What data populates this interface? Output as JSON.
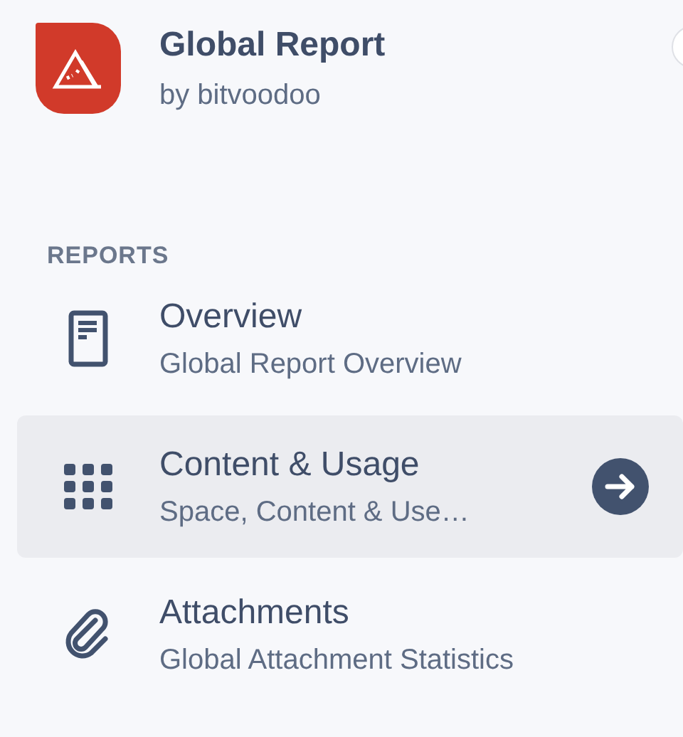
{
  "app": {
    "title": "Global Report",
    "subtitle": "by bitvoodoo"
  },
  "section": {
    "heading": "REPORTS"
  },
  "items": [
    {
      "kind": "document",
      "title": "Overview",
      "subtitle": "Global Report Overview",
      "selected": false
    },
    {
      "kind": "grid",
      "title": "Content & Usage",
      "subtitle": "Space, Content & Use…",
      "selected": true
    },
    {
      "kind": "paperclip",
      "title": "Attachments",
      "subtitle": "Global Attachment Statistics",
      "selected": false
    }
  ]
}
